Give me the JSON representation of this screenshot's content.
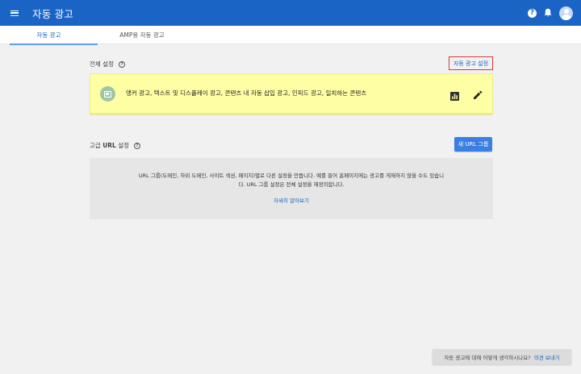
{
  "appbar": {
    "title": "자동 광고",
    "icons": [
      "menu-icon",
      "help-icon",
      "bell-icon",
      "avatar"
    ],
    "help_glyph": "?"
  },
  "tabs": [
    {
      "label": "자동 광고",
      "active": true
    },
    {
      "label": "AMP용 자동 광고",
      "active": false
    }
  ],
  "global_settings": {
    "header": "전체 설정",
    "link_label": "자동 광고 설정",
    "card_text": "앵커 광고, 텍스트 및 디스플레이 광고, 콘텐츠 내 자동 삽입 광고, 인피드 광고, 일치하는 콘텐츠",
    "card_icons": [
      "ad-format-icon",
      "bar-chart-icon",
      "edit-pencil-icon"
    ]
  },
  "advanced_url": {
    "header_prefix": "고급 ",
    "header_bold": "URL",
    "header_suffix": " 설정",
    "new_button_label": "새 URL 그룹",
    "description_line1": "URL 그룹(도메인, 하위 도메인, 사이트 섹션, 페이지)별로 다른 설정을 만듭니다. 예를 들어 홈페이지에는 광고를 게재하지 않을 수도 있습니",
    "description_line2": "다. URL 그룹 설정은 전체 설정을 재정의합니다.",
    "learn_more": "자세히 알아보기"
  },
  "feedback": {
    "question": "자동 광고에 대해 어떻게 생각하시나요?",
    "link": "의견 보내기"
  },
  "colors": {
    "appbar": "#1a64c6",
    "highlight_card": "#fefea4",
    "primary_button": "#3b7fe4",
    "link_outline": "#d23a3a"
  }
}
